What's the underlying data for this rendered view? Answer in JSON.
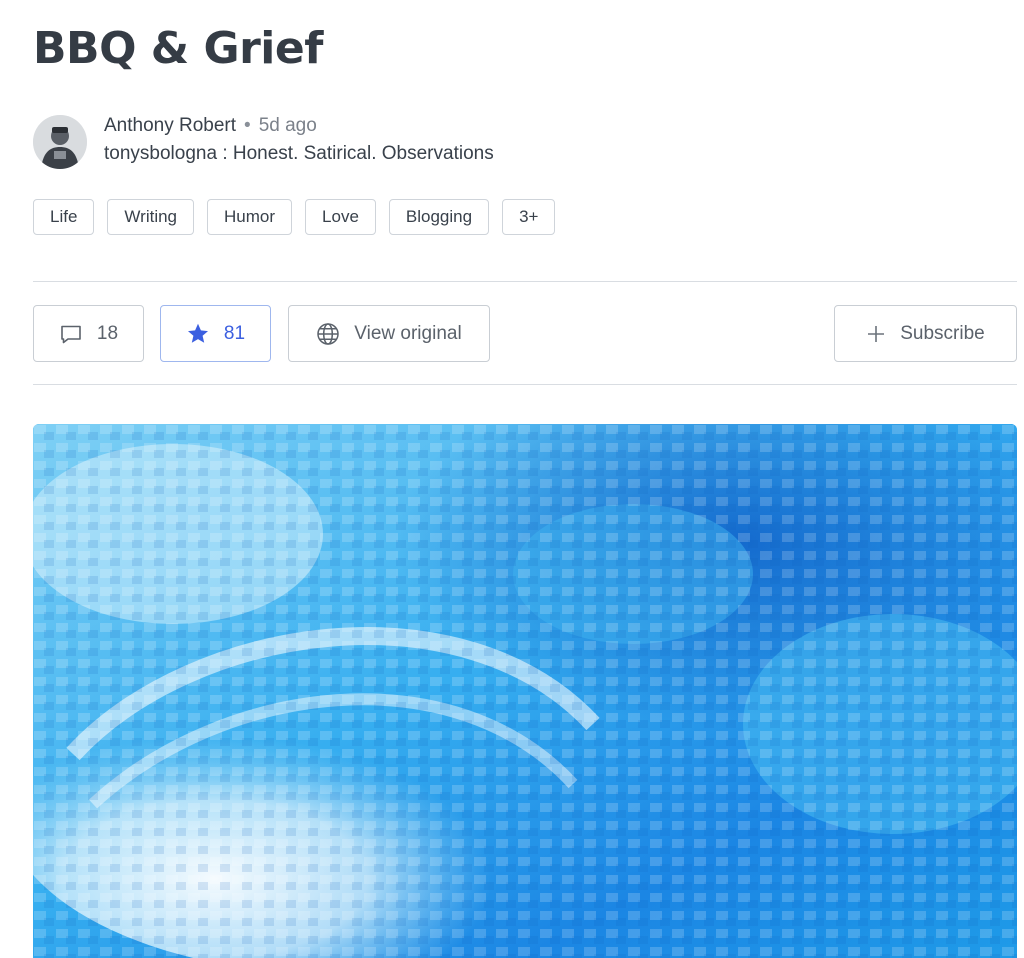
{
  "article": {
    "title": "BBQ & Grief",
    "author": "Anthony Robert",
    "separator": "•",
    "time_ago": "5d ago",
    "publication": "tonysbologna : Honest. Satirical. Observations"
  },
  "tags": [
    "Life",
    "Writing",
    "Humor",
    "Love",
    "Blogging",
    "3+"
  ],
  "actions": {
    "comments_count": "18",
    "stars_count": "81",
    "view_original_label": "View original",
    "subscribe_label": "Subscribe"
  },
  "icons": {
    "comments": "comment-icon",
    "stars": "star-icon",
    "original": "globe-icon",
    "subscribe": "plus-icon"
  },
  "colors": {
    "accent": "#3b5fe0",
    "text": "#353c45",
    "border": "#c9ced4"
  }
}
